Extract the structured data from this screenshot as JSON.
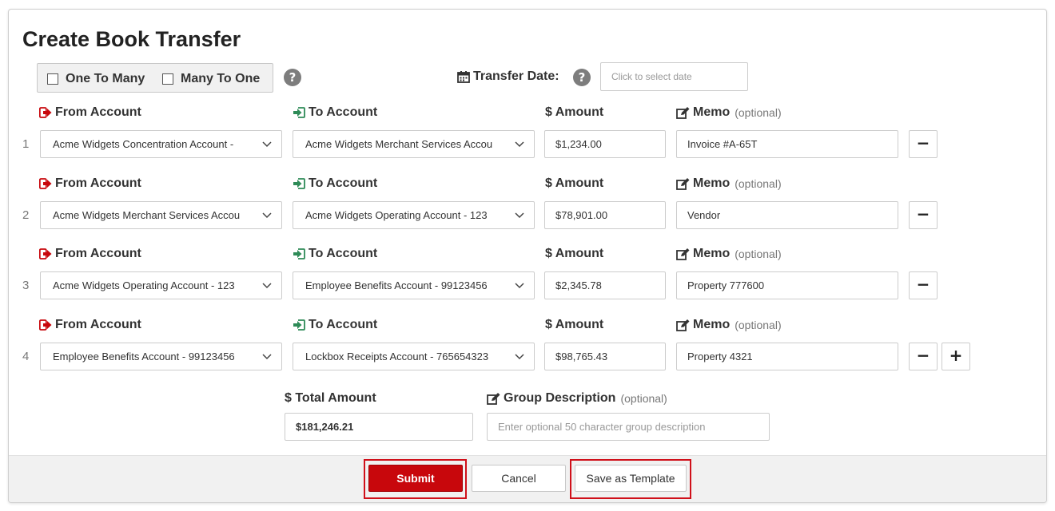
{
  "title": "Create Book Transfer",
  "mode": {
    "one_to_many_label": "One To Many",
    "many_to_one_label": "Many To One"
  },
  "transfer_date": {
    "label": "Transfer Date:",
    "placeholder": "Click to select date"
  },
  "labels": {
    "from_account": "From Account",
    "to_account": "To Account",
    "amount": "$ Amount",
    "memo": "Memo",
    "optional": "(optional)"
  },
  "rows": [
    {
      "num": "1",
      "from": "Acme Widgets Concentration Account -",
      "to": "Acme Widgets Merchant Services Accou",
      "amount": "$1,234.00",
      "memo": "Invoice #A-65T"
    },
    {
      "num": "2",
      "from": "Acme Widgets Merchant Services Accou",
      "to": "Acme Widgets Operating Account - 123",
      "amount": "$78,901.00",
      "memo": "Vendor"
    },
    {
      "num": "3",
      "from": "Acme Widgets Operating Account - 123",
      "to": "Employee Benefits Account - 99123456",
      "amount": "$2,345.78",
      "memo": "Property 777600"
    },
    {
      "num": "4",
      "from": "Employee Benefits Account - 99123456",
      "to": "Lockbox Receipts Account - 765654323",
      "amount": "$98,765.43",
      "memo": "Property 4321"
    }
  ],
  "row_buttons": {
    "remove": "−",
    "add": "+"
  },
  "total": {
    "label": "$ Total Amount",
    "value": "$181,246.21"
  },
  "group_description": {
    "label": "Group Description",
    "optional": "(optional)",
    "placeholder": "Enter optional 50 character group description"
  },
  "buttons": {
    "submit": "Submit",
    "cancel": "Cancel",
    "save_template": "Save as Template"
  },
  "colors": {
    "accent": "#c8070c",
    "to_icon": "#2e8b57",
    "highlight": "#d0101a"
  }
}
